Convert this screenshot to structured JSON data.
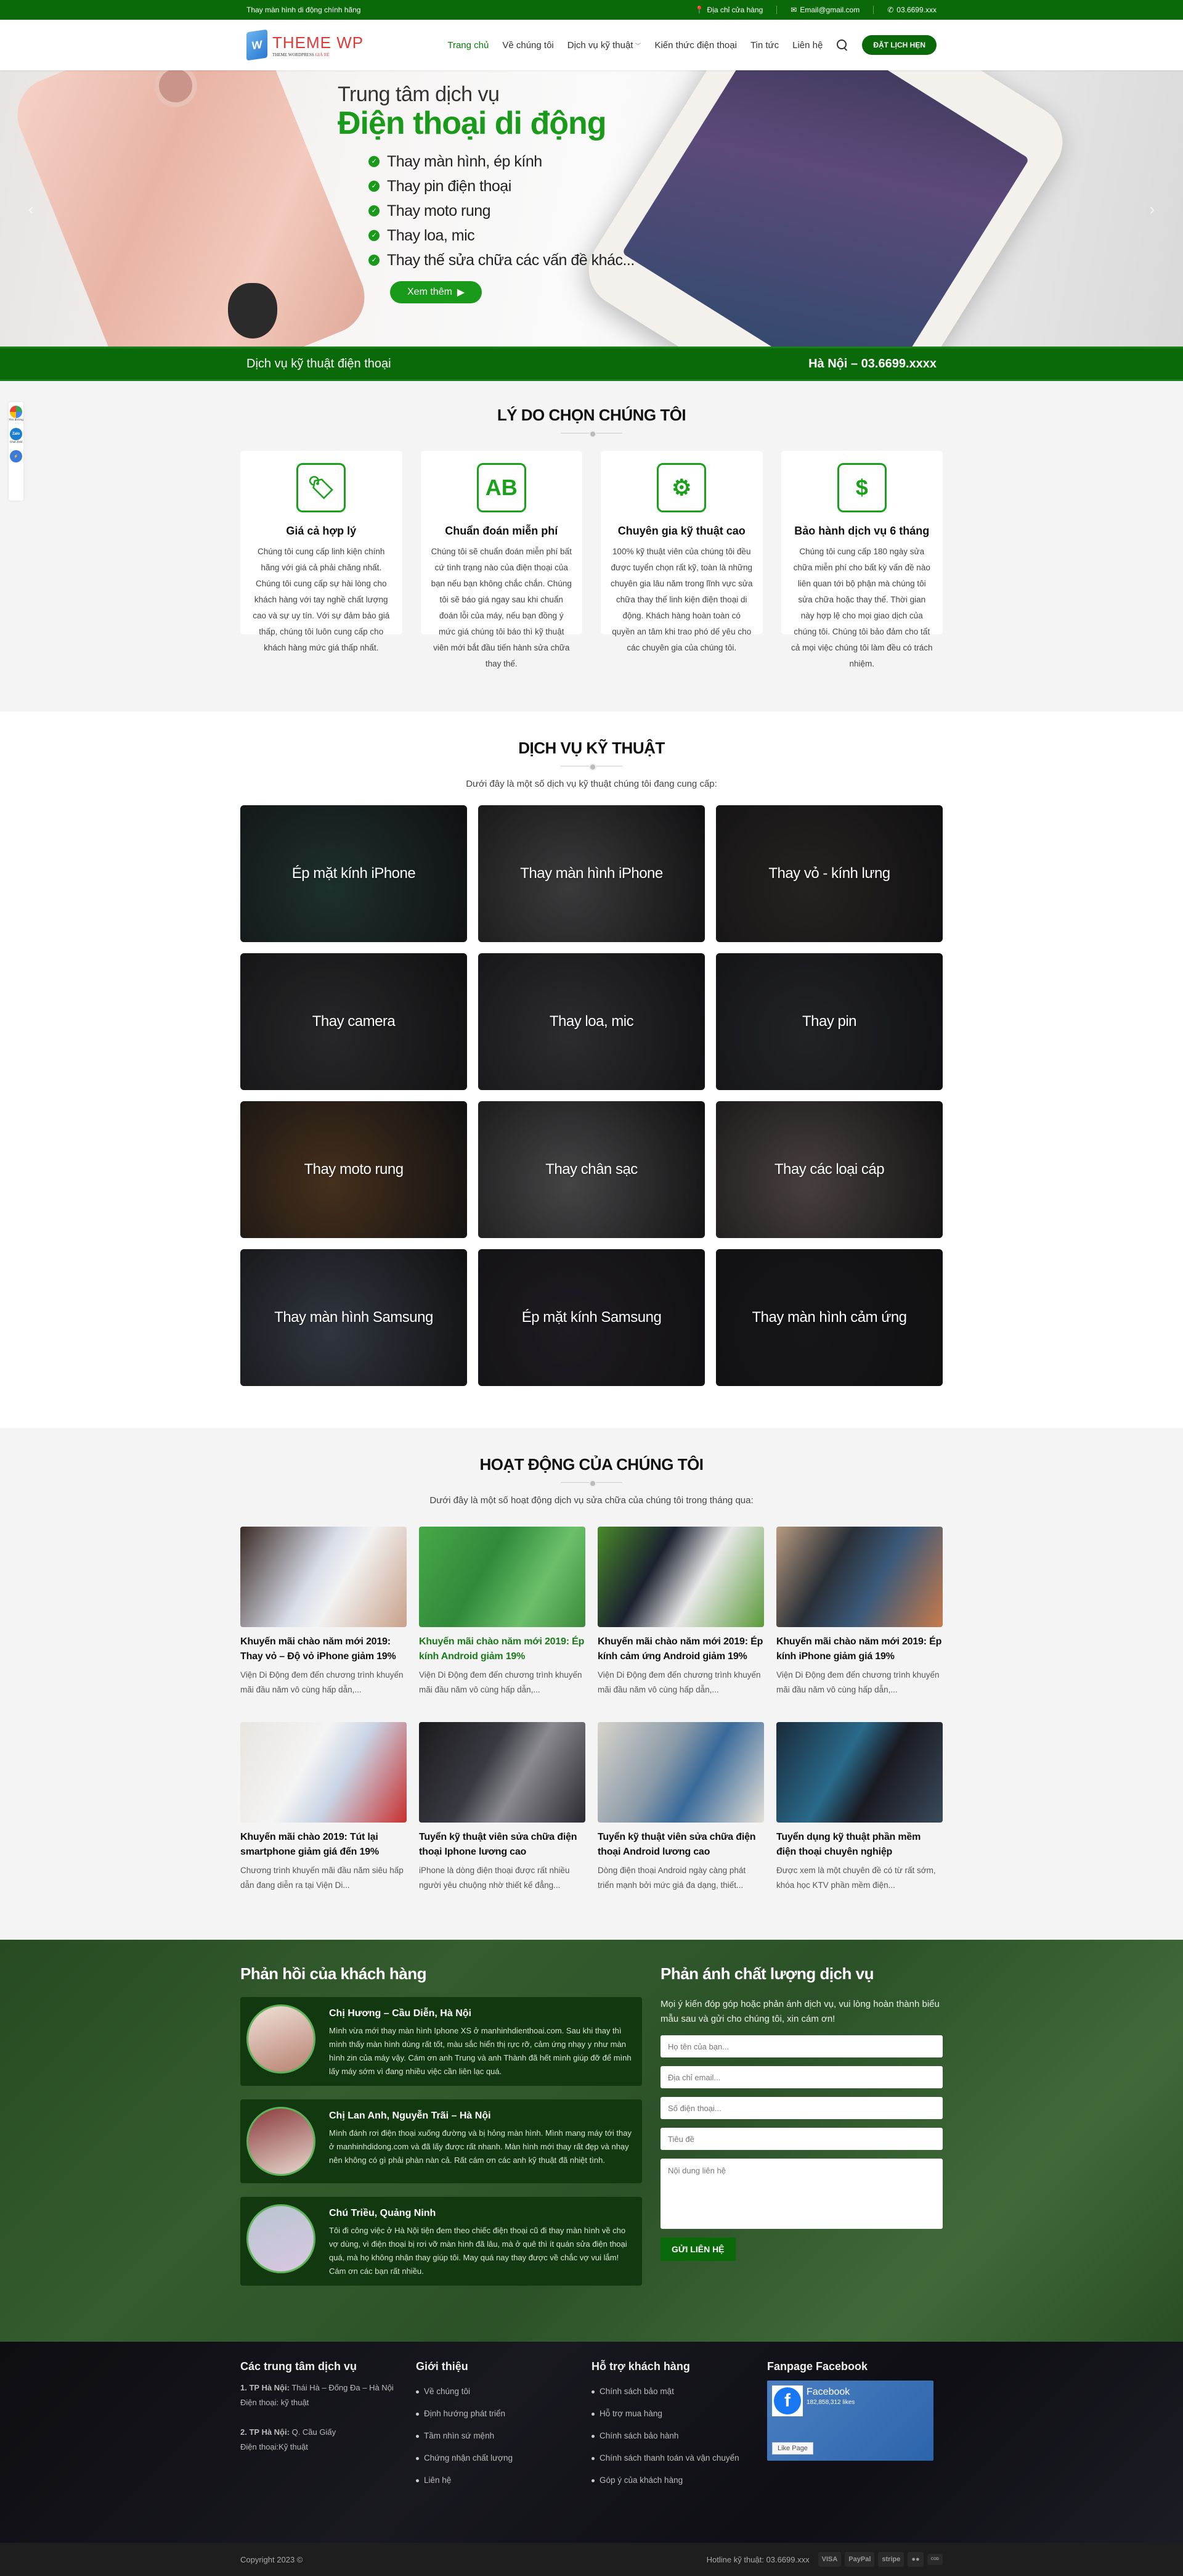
{
  "topbar": {
    "tagline": "Thay màn hình di động chính hãng",
    "address_label": "Địa chỉ cửa hàng",
    "email": "Email@gmail.com",
    "phone": "03.6699.xxx"
  },
  "header": {
    "logo_main": "THEME WP",
    "logo_sub": "THEME WORDPRESS",
    "logo_sub_accent": "GIÁ RẺ",
    "nav": [
      "Trang chủ",
      "Về chúng tôi",
      "Dịch vụ kỹ thuật",
      "Kiến thức điện thoại",
      "Tin tức",
      "Liên hệ"
    ],
    "book_label": "ĐẶT LỊCH HẸN"
  },
  "hero": {
    "title_line1": "Trung tâm dịch vụ",
    "title_line2": "Điện thoại di động",
    "items": [
      "Thay màn hình, ép kính",
      "Thay pin điện thoại",
      "Thay moto rung",
      "Thay loa, mic",
      "Thay thế sửa chữa các vấn đề khác..."
    ],
    "more_label": "Xem thêm"
  },
  "strip": {
    "left": "Dịch vụ kỹ thuật điện thoại",
    "right": "Hà Nội – 03.6699.xxxx"
  },
  "side_float": {
    "items": [
      "Tìm đường",
      "Chat Zalo",
      "Messenger"
    ]
  },
  "reasons": {
    "title": "LÝ DO CHỌN CHÚNG TÔI",
    "items": [
      {
        "icon": "price-tag-icon",
        "title": "Giá cả hợp lý",
        "text": "Chúng tôi cung cấp linh kiện chính hãng với giá cả phải chăng nhất. Chúng tôi cung cấp sự hài lòng cho khách hàng với tay nghề chất lượng cao và sự uy tín.  Với sự đảm bảo giá thấp, chúng tôi luôn cung cấp cho khách hàng mức giá thấp nhất."
      },
      {
        "icon": "diagnosis-icon",
        "title": "Chuẩn đoán miễn phí",
        "text": "Chúng tôi sẽ chuẩn đoán miễn phí bất cứ tình trạng nào của điện thoại của bạn nếu bạn không chắc chắn. Chúng tôi sẽ báo giá ngay sau khi chuẩn đoán lỗi của máy, nếu bạn đồng ý mức giá chúng tôi báo thì kỹ thuật viên mới bắt đầu tiến hành sửa chữa thay thế."
      },
      {
        "icon": "expert-gear-icon",
        "title": "Chuyên gia kỹ thuật cao",
        "text": "100% kỹ thuật viên của chúng tôi đều được tuyển chọn rất kỹ, toàn là những chuyên gia lâu năm trong lĩnh vực sửa chữa thay thế linh kiện điện thoại di động. Khách hàng hoàn toàn có quyền an tâm khi trao phó dế yêu cho các chuyên gia của chúng tôi."
      },
      {
        "icon": "warranty-document-icon",
        "title": "Bảo hành dịch vụ 6 tháng",
        "text": "Chúng tôi cung cấp 180 ngày sửa chữa miễn phí cho bất kỳ vấn đề nào liên quan tới bộ phận mà chúng tôi sửa chữa hoặc thay thế. Thời gian này hợp lệ cho mọi giao dịch của chúng tôi. Chúng tôi bảo đảm cho tất cả mọi việc chúng tôi làm đều có trách nhiệm."
      }
    ]
  },
  "services": {
    "title": "DỊCH VỤ KỸ THUẬT",
    "subtitle": "Dưới đây là một số dịch vụ kỹ thuật chúng tôi đang cung cấp:",
    "items": [
      {
        "label": "Ép mặt kính iPhone",
        "color": "#2d4a45"
      },
      {
        "label": "Thay màn hình iPhone",
        "color": "#5a5a5c"
      },
      {
        "label": "Thay vỏ - kính lưng",
        "color": "#3a3432"
      },
      {
        "label": "Thay camera",
        "color": "#3c3b3e"
      },
      {
        "label": "Thay loa, mic",
        "color": "#44444a"
      },
      {
        "label": "Thay pin",
        "color": "#34363c"
      },
      {
        "label": "Thay moto rung",
        "color": "#6b4a2c"
      },
      {
        "label": "Thay chân sạc",
        "color": "#6a6a6c"
      },
      {
        "label": "Thay các loại cáp",
        "color": "#6e6260"
      },
      {
        "label": "Thay màn hình Samsung",
        "color": "#4a5260"
      },
      {
        "label": "Ép mặt kính Samsung",
        "color": "#2e2a34"
      },
      {
        "label": "Thay màn hình cảm ứng",
        "color": "#222226"
      }
    ]
  },
  "activities": {
    "title": "HOẠT ĐỘNG CỦA CHÚNG TÔI",
    "subtitle": "Dưới đây là một số hoạt động dịch vụ sửa chữa của chúng tôi trong tháng qua:",
    "posts": [
      {
        "title": "Khuyến mãi chào năm mới 2019: Thay vỏ – Độ vỏ iPhone giảm 19%",
        "excerpt": "Viện Di Động đem đến chương trình khuyến mãi đầu năm vô cùng hấp dẫn,...",
        "img": "linear-gradient(120deg,#3a2a25,#d8dde8 45%,#f2f2f2 60%,#c8a08a)"
      },
      {
        "title": "Khuyến mãi chào năm mới 2019: Ép kính Android giảm 19%",
        "excerpt": "Viện Di Động đem đến chương trình khuyến mãi đầu năm vô cùng hấp dẫn,...",
        "img": "linear-gradient(120deg,#48a848,#2f8a3a 40%,#6cc06a 70%,#3a8a3a)",
        "highlight": true
      },
      {
        "title": "Khuyến mãi chào năm mới 2019: Ép kính cảm ứng Android giảm 19%",
        "excerpt": "Viện Di Động đem đến chương trình khuyến mãi đầu năm vô cùng hấp dẫn,...",
        "img": "linear-gradient(120deg,#4a8a2a,#1c2230 35%,#e8e8e8 60%,#5a9a3a)"
      },
      {
        "title": "Khuyến mãi chào năm mới 2019: Ép kính iPhone giảm giá 19%",
        "excerpt": "Viện Di Động đem đến chương trình khuyến mãi đầu năm vô cùng hấp dẫn,...",
        "img": "linear-gradient(120deg,#b89a80,#2a3038 35%,#3c5a7a 60%,#c87a4a)"
      },
      {
        "title": "Khuyến mãi chào 2019: Tút lại smartphone giảm giá đến 19%",
        "excerpt": "Chương trình khuyến mãi đầu năm siêu hấp dẫn đang diễn ra tại Viện Di...",
        "img": "linear-gradient(120deg,#e8e4e0,#f4f4f4 40%,#c9d4e4 60%,#c83030)"
      },
      {
        "title": "Tuyển kỹ thuật viên sửa chữa điện thoại Iphone lương cao",
        "excerpt": "iPhone là dòng điện thoại được rất nhiều người yêu chuộng nhờ thiết kế đẳng...",
        "img": "linear-gradient(120deg,#1a1a1e,#3a3a42 40%,#8a8a90 60%,#2a2a30)"
      },
      {
        "title": "Tuyển kỹ thuật viên sửa chữa điện thoại Android lương cao",
        "excerpt": "Dòng điện thoại Android ngày càng phát triển mạnh bởi mức giá đa dạng, thiết...",
        "img": "linear-gradient(120deg,#d8d4cc,#8a9aa8 40%,#3a6a9a 60%,#e4e0d8)"
      },
      {
        "title": "Tuyển dụng kỹ thuật phần mềm điện thoại chuyên nghiệp",
        "excerpt": "Được xem là một chuyên đề có từ rất sớm, khóa học KTV phần mềm điện...",
        "img": "linear-gradient(120deg,#1a2a3a,#2a6a8a 40%,#1a1a22 60%,#3a4a5a)"
      }
    ]
  },
  "feedback": {
    "title": "Phản hồi của khách hàng",
    "testimonials": [
      {
        "name": "Chị Hương – Cầu Diễn, Hà Nội",
        "text": "Mình vừa mới thay màn hình Iphone XS ở manhinhdienthoai.com. Sau khi thay thì mình thấy màn hình dùng rất tốt, màu sắc hiển thị rực rỡ, cảm ứng nhạy y như màn hình zin của máy vậy. Cám ơn anh Trung và anh Thành đã hết mình giúp đỡ để mình lấy máy sớm vì đang nhiều việc cần liên lạc quá."
      },
      {
        "name": "Chị Lan Anh, Nguyễn Trãi – Hà Nội",
        "text": "Mình đánh rơi điện thoại xuống đường và bị hỏng màn hình. Mình mang máy tới thay ở manhinhdidong.com và đã lấy được rất nhanh. Màn hình mới thay rất đẹp và nhạy nên không có gì phải phàn nàn cả. Rất cám ơn các anh kỹ thuật đã nhiệt tình."
      },
      {
        "name": "Chú Triều, Quảng Ninh",
        "text": "Tôi đi công việc ở Hà Nội tiện đem theo chiếc điện thoại cũ đi thay màn hình về cho vợ dùng, vì điện thoại bị rơi vỡ màn hình đã lâu, mà ở quê thì ít quán sửa điện thoại quá, mà họ không nhận thay giúp tôi. May quá nay thay được về chắc vợ vui lắm! Cám ơn các bạn rất nhiều."
      }
    ],
    "form_title": "Phản ánh chất lượng dịch vụ",
    "form_desc": "Mọi ý kiến đóp góp hoặc phản ánh dịch vụ, vui lòng hoàn thành biểu mẫu sau và gửi cho chúng tôi, xin cám ơn!",
    "fields": {
      "name": "Họ tên của bạn...",
      "email": "Địa chỉ email...",
      "phone": "Số điện thoại...",
      "subject": "Tiêu đề",
      "message": "Nội dung liên hệ"
    },
    "submit_label": "GỬI LIÊN HỆ"
  },
  "footer": {
    "centers_title": "Các trung tâm dịch vụ",
    "centers": [
      {
        "label": "1. TP Hà Nội:",
        "addr": "Thái Hà – Đống Đa – Hà Nội",
        "phone": "Điện thoại: kỹ thuật"
      },
      {
        "label": "2. TP Hà Nội:",
        "addr": "Q. Cầu Giấy",
        "phone": "Điện thoại:Kỹ thuật"
      }
    ],
    "about_title": "Giới thiệu",
    "about_links": [
      "Về chúng tôi",
      "Định hướng phát triển",
      "Tầm nhìn sứ mệnh",
      "Chứng nhận chất lượng",
      "Liên hệ"
    ],
    "support_title": "Hỗ trợ khách hàng",
    "support_links": [
      "Chính sách bảo mật",
      "Hỗ trợ mua hàng",
      "Chính sách bảo hành",
      "Chính sách thanh toán và vận chuyển",
      "Góp ý của khách hàng"
    ],
    "fanpage_title": "Fanpage Facebook",
    "fb_name": "Facebook",
    "fb_likes": "182,858,312 likes",
    "fb_like_label": "Like Page"
  },
  "copyright": {
    "text": "Copyright 2023 ©",
    "hotline": "Hotline kỹ thuật: 03.6699.xxx",
    "payments": [
      "VISA",
      "PayPal",
      "stripe",
      "MasterCard",
      "CASH ON DELIVERY"
    ]
  },
  "colors": {
    "brand_green": "#0a6a0a",
    "accent_green": "#1a9a1a",
    "logo_red": "#e03a3a"
  }
}
